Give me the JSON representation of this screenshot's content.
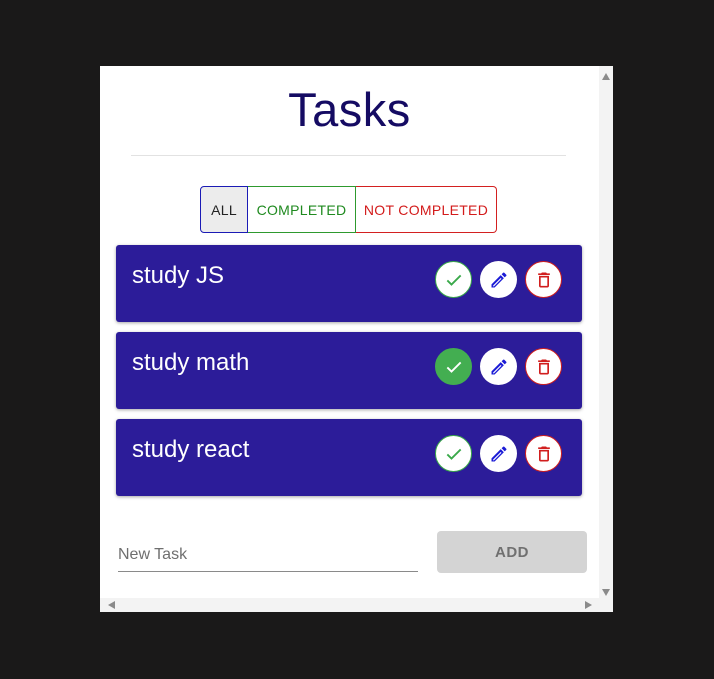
{
  "app": {
    "title": "Tasks"
  },
  "filters": {
    "all": "ALL",
    "completed": "COMPLETED",
    "not_completed": "NOT COMPLETED"
  },
  "tasks": [
    {
      "label": "study JS",
      "completed": false
    },
    {
      "label": "study math",
      "completed": true
    },
    {
      "label": "study react",
      "completed": false
    }
  ],
  "new_task": {
    "placeholder": "New Task",
    "value": ""
  },
  "add_button": {
    "label": "ADD"
  },
  "colors": {
    "title": "#150b63",
    "task_bg": "#2c1c99",
    "complete_green": "#43ae51",
    "delete_red": "#d11e1e",
    "edit_blue": "#1b1bd6"
  },
  "icons": {
    "complete": "check-icon",
    "edit": "pencil-icon",
    "delete": "trash-icon"
  }
}
